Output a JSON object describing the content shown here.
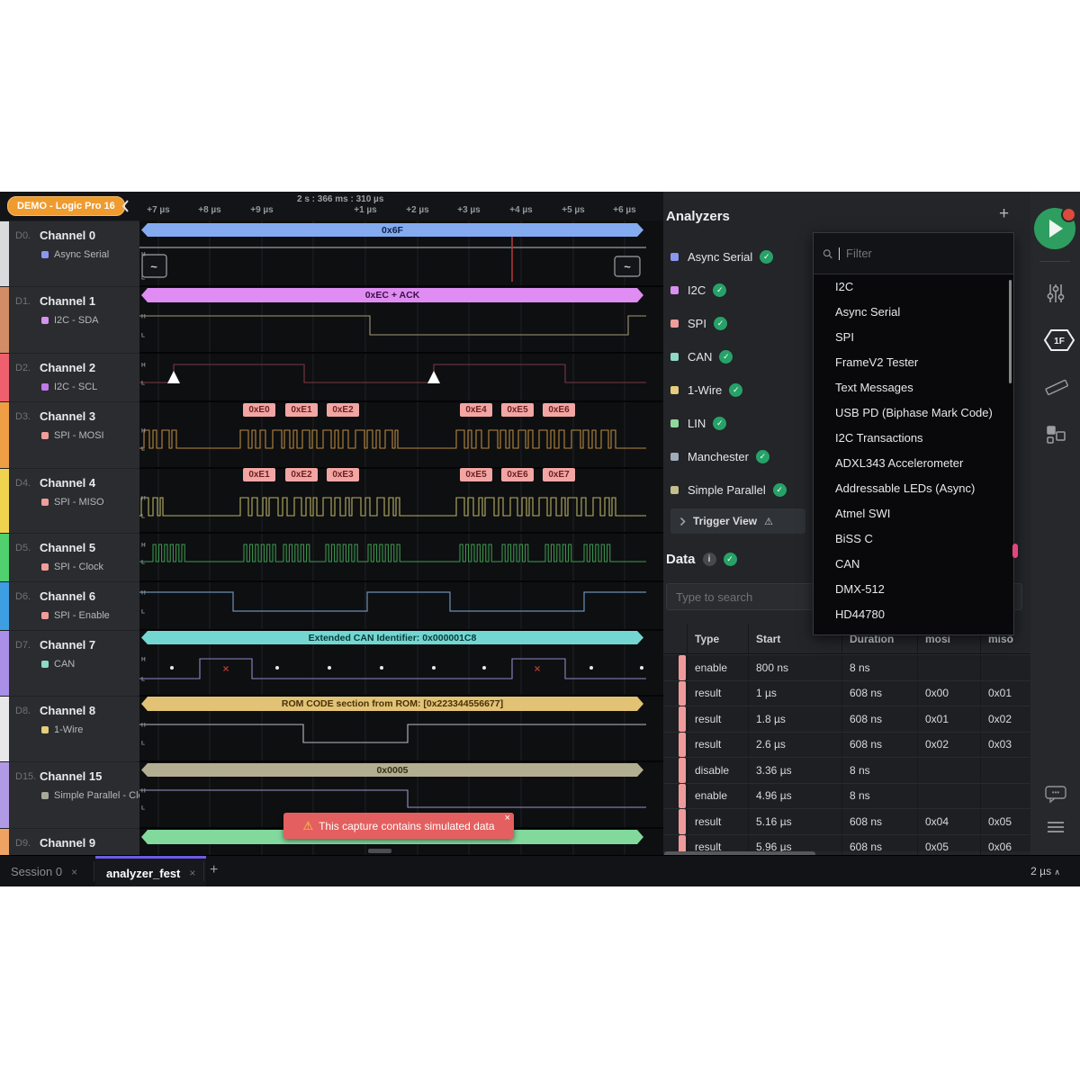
{
  "window": {
    "badge": "DEMO - Logic Pro 16",
    "time_ruler_label": "2 s : 366 ms : 310 µs",
    "ticks": [
      "+7 µs",
      "+8 µs",
      "+9 µs",
      "+1 µs",
      "+2 µs",
      "+3 µs",
      "+4 µs",
      "+5 µs",
      "+6 µs"
    ]
  },
  "channels": [
    {
      "id": "D0.",
      "name": "Channel 0",
      "protocol": "Async Serial",
      "dot": "#8b97ef",
      "strip": "#d9dadb"
    },
    {
      "id": "D1.",
      "name": "Channel 1",
      "protocol": "I2C - SDA",
      "dot": "#d792ef",
      "strip": "#d28c66"
    },
    {
      "id": "D2.",
      "name": "Channel 2",
      "protocol": "I2C - SCL",
      "dot": "#c07ae8",
      "strip": "#ef5f6d"
    },
    {
      "id": "D3.",
      "name": "Channel 3",
      "protocol": "SPI - MOSI",
      "dot": "#ef9d9b",
      "strip": "#ee9e44"
    },
    {
      "id": "D4.",
      "name": "Channel 4",
      "protocol": "SPI - MISO",
      "dot": "#ef9d9b",
      "strip": "#efd34f"
    },
    {
      "id": "D5.",
      "name": "Channel 5",
      "protocol": "SPI - Clock",
      "dot": "#ef9d9b",
      "strip": "#50d06e"
    },
    {
      "id": "D6.",
      "name": "Channel 6",
      "protocol": "SPI - Enable",
      "dot": "#ef9d9b",
      "strip": "#3e9ee2"
    },
    {
      "id": "D7.",
      "name": "Channel 7",
      "protocol": "CAN",
      "dot": "#8fd9c9",
      "strip": "#a98fe8"
    },
    {
      "id": "D8.",
      "name": "Channel 8",
      "protocol": "1-Wire",
      "dot": "#e5cd7d",
      "strip": "#e8e8e8"
    },
    {
      "id": "D15.",
      "name": "Channel 15",
      "protocol": "Simple Parallel - Clo...",
      "dot": "#a9a99a",
      "strip": "#b19ae5"
    },
    {
      "id": "D9.",
      "name": "Channel 9",
      "protocol": "",
      "dot": "#90d99c",
      "strip": "#eea365"
    }
  ],
  "wave_bubbles": {
    "d0": "0x6F",
    "d1": "0xEC + ACK",
    "d3": [
      "0xE0",
      "0xE1",
      "0xE2",
      "0xE4",
      "0xE5",
      "0xE6"
    ],
    "d4": [
      "0xE1",
      "0xE2",
      "0xE3",
      "0xE5",
      "0xE6",
      "0xE7"
    ],
    "d7": "Extended CAN Identifier: 0x000001C8",
    "d8": "ROM CODE section from ROM: [0x223344556677]",
    "d15": "0x0005"
  },
  "toast": {
    "icon": "warning-triangle",
    "text": "This capture contains simulated data",
    "close": "×"
  },
  "analyzers": {
    "title": "Analyzers",
    "add_label": "+",
    "items": [
      {
        "label": "Async Serial",
        "color": "#8b97ef"
      },
      {
        "label": "I2C",
        "color": "#d792ef"
      },
      {
        "label": "SPI",
        "color": "#ef9d9b"
      },
      {
        "label": "CAN",
        "color": "#8fd9c9"
      },
      {
        "label": "1-Wire",
        "color": "#e5cd7d"
      },
      {
        "label": "LIN",
        "color": "#90d99c"
      },
      {
        "label": "Manchester",
        "color": "#a0acb9"
      },
      {
        "label": "Simple Parallel",
        "color": "#c5bd8d"
      }
    ],
    "trigger_view": "Trigger View"
  },
  "data_panel": {
    "title": "Data",
    "search_placeholder": "Type to search",
    "columns": [
      "Type",
      "Start",
      "Duration",
      "mosi",
      "miso"
    ],
    "rows": [
      {
        "type": "enable",
        "start": "800 ns",
        "duration": "8 ns",
        "mosi": "",
        "miso": ""
      },
      {
        "type": "result",
        "start": "1 µs",
        "duration": "608 ns",
        "mosi": "0x00",
        "miso": "0x01"
      },
      {
        "type": "result",
        "start": "1.8 µs",
        "duration": "608 ns",
        "mosi": "0x01",
        "miso": "0x02"
      },
      {
        "type": "result",
        "start": "2.6 µs",
        "duration": "608 ns",
        "mosi": "0x02",
        "miso": "0x03"
      },
      {
        "type": "disable",
        "start": "3.36 µs",
        "duration": "8 ns",
        "mosi": "",
        "miso": ""
      },
      {
        "type": "enable",
        "start": "4.96 µs",
        "duration": "8 ns",
        "mosi": "",
        "miso": ""
      },
      {
        "type": "result",
        "start": "5.16 µs",
        "duration": "608 ns",
        "mosi": "0x04",
        "miso": "0x05"
      },
      {
        "type": "result",
        "start": "5.96 µs",
        "duration": "608 ns",
        "mosi": "0x05",
        "miso": "0x06"
      }
    ]
  },
  "analyzer_dropdown": {
    "filter_placeholder": "Filter",
    "items": [
      "I2C",
      "Async Serial",
      "SPI",
      "FrameV2 Tester",
      "Text Messages",
      "USB PD (Biphase Mark Code)",
      "I2C Transactions",
      "ADXL343 Accelerometer",
      "Addressable LEDs (Async)",
      "Atmel SWI",
      "BiSS C",
      "CAN",
      "DMX-512",
      "HD44780"
    ]
  },
  "session_tabs": {
    "tabs": [
      {
        "label": "Session 0",
        "close": "×",
        "active": false
      },
      {
        "label": "analyzer_fest",
        "close": "×",
        "active": true
      }
    ],
    "add_label": "+",
    "zoom_level": "2 µs",
    "zoom_caret": "∧"
  },
  "toolbar_icons": [
    "record-play",
    "tune-sliders",
    "frame-1f-hexagon",
    "measure-ruler",
    "layout-grid",
    "annotations-chat",
    "menu-lines"
  ],
  "colors": {
    "accent_purple": "#6c5ce7",
    "record_green": "#2e9e60",
    "notification_red": "#dd4a3c",
    "toast_red": "#e45f5f",
    "row_dot": "#ef9a9a"
  }
}
